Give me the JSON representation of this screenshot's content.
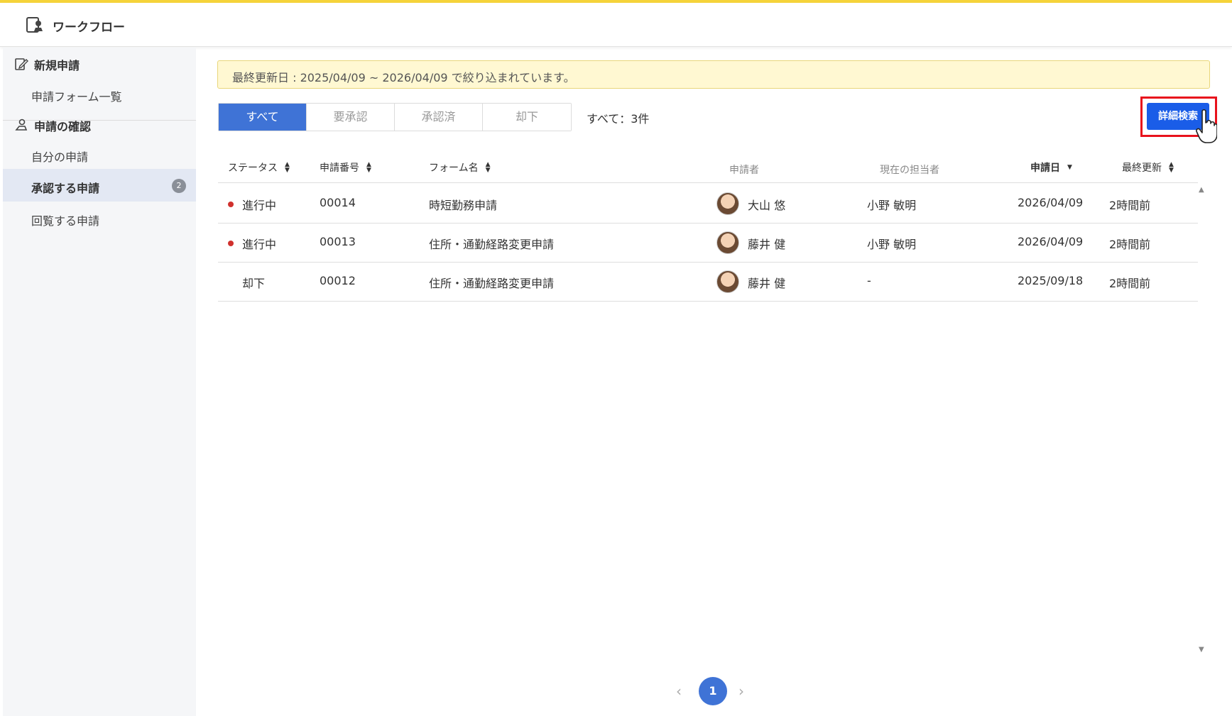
{
  "header": {
    "title": "ワークフロー",
    "logo_icon": "workflow-stamp-icon"
  },
  "sidebar": {
    "new_request": {
      "label": "新規申請",
      "icon": "edit-document-icon"
    },
    "form_list": "申請フォーム一覧",
    "confirm": {
      "label": "申請の確認",
      "icon": "stamp-icon"
    },
    "my_requests": "自分の申請",
    "approve_requests": {
      "label": "承認する申請",
      "badge": "2"
    },
    "circulate_requests": "回覧する申請"
  },
  "notice": "最終更新日 : 2025/04/09 ~ 2026/04/09 で絞り込まれています。",
  "tabs": [
    "すべて",
    "要承認",
    "承認済",
    "却下"
  ],
  "count": "すべて：3件",
  "search_button": "詳細検索",
  "table": {
    "headers": {
      "status": "ステータス",
      "number": "申請番号",
      "form": "フォーム名",
      "applicant": "申請者",
      "assignee": "現在の担当者",
      "date": "申請日",
      "updated": "最終更新"
    },
    "rows": [
      {
        "status": "進行中",
        "in_progress": true,
        "number": "00014",
        "form": "時短勤務申請",
        "applicant": "大山 悠",
        "assignee": "小野 敏明",
        "date": "2026/04/09",
        "updated": "2時間前"
      },
      {
        "status": "進行中",
        "in_progress": true,
        "number": "00013",
        "form": "住所・通勤経路変更申請",
        "applicant": "藤井 健",
        "assignee": "小野 敏明",
        "date": "2026/04/09",
        "updated": "2時間前"
      },
      {
        "status": "却下",
        "in_progress": false,
        "number": "00012",
        "form": "住所・通勤経路変更申請",
        "applicant": "藤井 健",
        "assignee": "-",
        "date": "2025/09/18",
        "updated": "2時間前"
      }
    ]
  },
  "pagination": {
    "current": "1"
  },
  "colors": {
    "accent": "#3f73d6",
    "button": "#1a5de8",
    "highlight": "#e8121c",
    "status_dot": "#d0312d",
    "notice_bg": "#fff8d2"
  }
}
